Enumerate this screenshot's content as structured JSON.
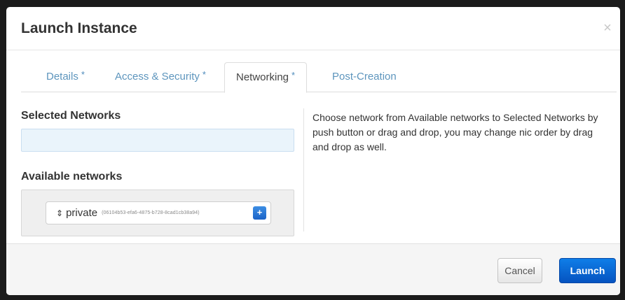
{
  "modal": {
    "title": "Launch Instance",
    "close_glyph": "×"
  },
  "tabs": [
    {
      "label": "Details",
      "required": "*"
    },
    {
      "label": "Access & Security",
      "required": "*"
    },
    {
      "label": "Networking",
      "required": "*",
      "active": true
    },
    {
      "label": "Post-Creation",
      "required": ""
    }
  ],
  "networking": {
    "selected_label": "Selected Networks",
    "available_label": "Available networks",
    "available": [
      {
        "name": "private",
        "id": "(06104b53-efa6-4875-b728-8cad1cb38a94)",
        "add_glyph": "+"
      }
    ],
    "sort_glyph": "⇕",
    "help": "Choose network from Available networks to Selected Networks by push button or drag and drop, you may change nic order by drag and drop as well."
  },
  "footer": {
    "cancel_label": "Cancel",
    "launch_label": "Launch"
  },
  "colors": {
    "accent": "#0553c0",
    "tab_link": "#5d95bd",
    "selected_bg": "#eaf4fb"
  }
}
